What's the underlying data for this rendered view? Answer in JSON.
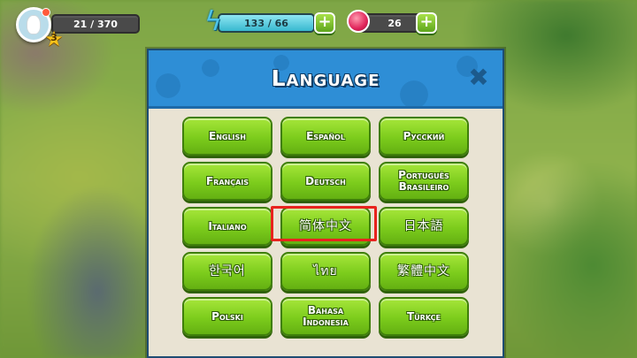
{
  "hud": {
    "level": "3",
    "xp_text": "21 / 370",
    "energy_text": "133 / 66",
    "energy_fill_percent": 100,
    "gems_text": "26",
    "plus_label": "+"
  },
  "modal": {
    "title": "Language",
    "close_label": "✖",
    "languages": [
      {
        "label": "English"
      },
      {
        "label": "Español"
      },
      {
        "label": "Русский"
      },
      {
        "label": "Français"
      },
      {
        "label": "Deutsch"
      },
      {
        "label": "Português Brasileiro"
      },
      {
        "label": "Italiano"
      },
      {
        "label": "简体中文",
        "highlighted": true
      },
      {
        "label": "日本語"
      },
      {
        "label": "한국어"
      },
      {
        "label": "ไทย"
      },
      {
        "label": "繁體中文"
      },
      {
        "label": "Polski"
      },
      {
        "label": "Bahasa Indonesia"
      },
      {
        "label": "Türkçe"
      }
    ]
  },
  "colors": {
    "button_green": "#7ccc1c",
    "header_blue": "#2e8ed6",
    "highlight_red": "#e8231e"
  }
}
